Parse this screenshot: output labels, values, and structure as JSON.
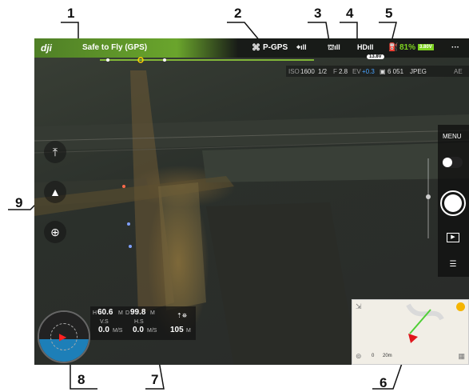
{
  "callouts": [
    "1",
    "2",
    "3",
    "4",
    "5",
    "6",
    "7",
    "8",
    "9"
  ],
  "topbar": {
    "logo": "dji",
    "status": "Safe to Fly (GPS)",
    "mode": "P-GPS",
    "battery": "81%",
    "battery_voltage": "3.80V",
    "hd_badge": "13.8V",
    "more": "···"
  },
  "camera": {
    "iso_label": "ISO",
    "iso": "1600",
    "shutter": "1/2",
    "aperture_label": "F",
    "aperture": "2.8",
    "ev_label": "EV",
    "ev": "+0.3",
    "photos": "6 051",
    "format": "JPEG",
    "af": "AE"
  },
  "right_panel": {
    "menu": "MENU"
  },
  "telemetry": {
    "h_label": "H",
    "h": "60.6",
    "h_unit": "M",
    "d_label": "D",
    "d": "99.8",
    "d_unit": "M",
    "vs_label": "V.S",
    "vs": "0.0",
    "vs_unit": "M/S",
    "hs_label": "H.S",
    "hs": "0.0",
    "hs_unit": "M/S",
    "dist": "105",
    "dist_unit": "M"
  },
  "map": {
    "scale": "20m",
    "scale_zero": "0"
  },
  "colors": {
    "safe_green": "#6aa52c",
    "battery_green": "#7ed321",
    "ev_blue": "#4aa3ff",
    "radar_blue": "#1d7fb8"
  }
}
